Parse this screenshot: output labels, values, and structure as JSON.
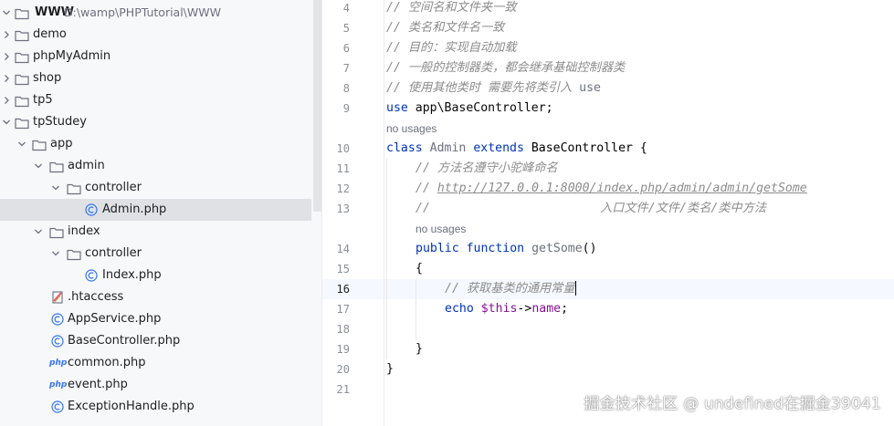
{
  "project_tree": {
    "root": {
      "name": "WWW",
      "path": "D:\\wamp\\PHPTutorial\\WWW"
    },
    "items": [
      {
        "label": "demo"
      },
      {
        "label": "phpMyAdmin"
      },
      {
        "label": "shop"
      },
      {
        "label": "tp5"
      },
      {
        "label": "tpStudey"
      },
      {
        "label": "app"
      },
      {
        "label": "admin"
      },
      {
        "label": "controller"
      },
      {
        "label": "Admin.php"
      },
      {
        "label": "index"
      },
      {
        "label": "controller"
      },
      {
        "label": "Index.php"
      },
      {
        "label": ".htaccess"
      },
      {
        "label": "AppService.php"
      },
      {
        "label": "BaseController.php"
      },
      {
        "label": "common.php"
      },
      {
        "label": "event.php"
      },
      {
        "label": "ExceptionHandle.php"
      }
    ],
    "php_badge": "php"
  },
  "editor": {
    "line_numbers": [
      "4",
      "5",
      "6",
      "7",
      "8",
      "9",
      "10",
      "11",
      "12",
      "13",
      "14",
      "15",
      "16",
      "17",
      "18",
      "19",
      "20",
      "21"
    ],
    "current_line": "16",
    "inlay_no_usages": "no usages",
    "code": {
      "l4": "// 空间名和文件夹一致",
      "l5": "// 类名和文件名一致",
      "l6": "// 目的：实现自动加载",
      "l7": "// 一般的控制器类，都会继承基础控制器类",
      "l8_comment": "// 使用其他类时 需要先将类引入 ",
      "l8_use": "use",
      "l9_kw": "use",
      "l9_rest": " app\\BaseController;",
      "l10_kw1": "class",
      "l10_name": "Admin",
      "l10_kw2": "extends",
      "l10_parent": "BaseController {",
      "l11": "// 方法名遵守小驼峰命名",
      "l12_prefix": "// ",
      "l12_url": "http://127.0.0.1:8000/index.php/admin/admin/getSome",
      "l13_prefix": "//",
      "l13_text": "入口文件/文件/类名/类中方法",
      "l14_kw1": "public",
      "l14_kw2": "function",
      "l14_fn": "getSome",
      "l14_paren": "()",
      "l15": "{",
      "l16": "// 获取基类的通用常量",
      "l17_kw": "echo",
      "l17_var": "$this",
      "l17_arrow": "->",
      "l17_prop": "name",
      "l17_end": ";",
      "l19": "}",
      "l20": "}"
    }
  },
  "watermark": "掘金技术社区 @ undefined在掘金39041",
  "colors": {
    "keyword": "#0033b3",
    "comment": "#8c8c8c",
    "function": "#00627a",
    "property": "#871094",
    "selection": "#dfe1e5",
    "current_line": "#f5f8fe"
  }
}
